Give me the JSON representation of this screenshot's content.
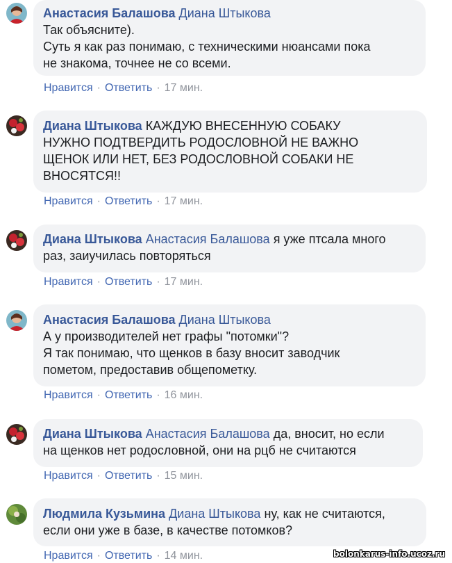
{
  "comments": [
    {
      "author": "Анастасия Балашова",
      "mention": "Диана Штыкова",
      "inline_text": "",
      "lines": [
        "Так объясните).",
        "Суть я как раз понимаю, с техническими нюансами пока",
        "не знакома, точнее не со всеми."
      ],
      "like_label": "Нравится",
      "reply_label": "Ответить",
      "time": "17 мин.",
      "avatar": "avatar-woman-red"
    },
    {
      "author": "Диана Штыкова",
      "mention": "",
      "inline_text": "КАЖДУЮ ВНЕСЕННУЮ СОБАКУ",
      "lines": [
        "НУЖНО ПОДТВЕРДИТЬ РОДОСЛОВНОЙ НЕ ВАЖНО",
        "ЩЕНОК ИЛИ НЕТ, БЕЗ РОДОСЛОВНОЙ СОБАКИ НЕ",
        "ВНОСЯТСЯ!!"
      ],
      "like_label": "Нравится",
      "reply_label": "Ответить",
      "time": "17 мин.",
      "avatar": "avatar-flowers"
    },
    {
      "author": "Диана Штыкова",
      "mention": "Анастасия Балашова",
      "inline_text": "я уже птсала много",
      "lines": [
        "раз, заиучилась повторяться"
      ],
      "like_label": "Нравится",
      "reply_label": "Ответить",
      "time": "17 мин.",
      "avatar": "avatar-flowers"
    },
    {
      "author": "Анастасия Балашова",
      "mention": "Диана Штыкова",
      "inline_text": "",
      "lines": [
        "А у производителей нет графы \"потомки\"?",
        "Я так понимаю, что щенков в базу вносит заводчик",
        "пометом, предоставив общепометку."
      ],
      "like_label": "Нравится",
      "reply_label": "Ответить",
      "time": "16 мин.",
      "avatar": "avatar-woman-red"
    },
    {
      "author": "Диана Штыкова",
      "mention": "Анастасия Балашова",
      "inline_text": "да, вносит, но если",
      "lines": [
        "на щенков нет родословной, они на рцб не считаются"
      ],
      "like_label": "Нравится",
      "reply_label": "Ответить",
      "time": "15 мин.",
      "avatar": "avatar-flowers"
    },
    {
      "author": "Людмила Кузьмина",
      "mention": "Диана Штыкова",
      "inline_text": "ну, как не считаются,",
      "lines": [
        "если они уже в базе, в качестве потомков?"
      ],
      "like_label": "Нравится",
      "reply_label": "Ответить",
      "time": "14 мин.",
      "avatar": "avatar-green"
    }
  ],
  "separator": "·",
  "watermark": "bolonkarus-info.ucoz.ru",
  "colors": {
    "bubble_bg": "#f2f3f5",
    "name_link": "#385898",
    "action_link": "#4267b2",
    "meta_gray": "#90949c"
  }
}
